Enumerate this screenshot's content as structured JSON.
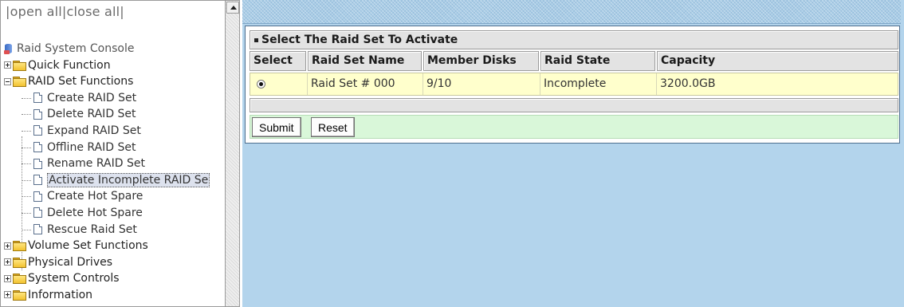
{
  "nav": {
    "open_all": "open all",
    "close_all": "close all",
    "separator": "|"
  },
  "tree": {
    "root": "Raid System Console",
    "nodes": [
      {
        "label": "Quick Function",
        "expanded": false
      },
      {
        "label": "RAID Set Functions",
        "expanded": true,
        "children": [
          "Create RAID Set",
          "Delete RAID Set",
          "Expand RAID Set",
          "Offline RAID Set",
          "Rename RAID Set",
          "Activate Incomplete RAID Se",
          "Create Hot Spare",
          "Delete Hot Spare",
          "Rescue Raid Set"
        ]
      },
      {
        "label": "Volume Set Functions",
        "expanded": false
      },
      {
        "label": "Physical Drives",
        "expanded": false
      },
      {
        "label": "System Controls",
        "expanded": false
      },
      {
        "label": "Information",
        "expanded": false
      }
    ],
    "selected": "Activate Incomplete RAID Se"
  },
  "form": {
    "title": "Select The Raid Set To Activate",
    "columns": [
      "Select",
      "Raid Set Name",
      "Member Disks",
      "Raid State",
      "Capacity"
    ],
    "rows": [
      {
        "selected": true,
        "name": "Raid Set # 000",
        "disks": "9/10",
        "state": "Incomplete",
        "capacity": "3200.0GB"
      }
    ],
    "submit_label": "Submit",
    "reset_label": "Reset"
  },
  "colors": {
    "frame_background": "#b3d4ec",
    "row_highlight": "#ffffcc",
    "button_bar": "#d9f7d9",
    "header_gray": "#e3e3e3"
  }
}
